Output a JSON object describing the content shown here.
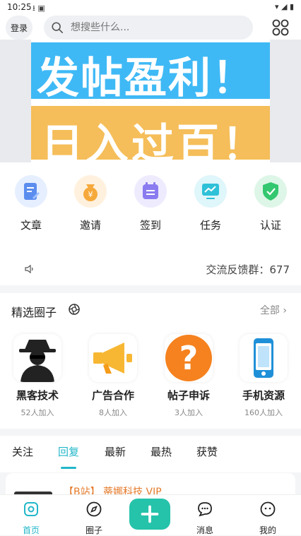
{
  "status_bar": {
    "time": "10:25"
  },
  "header": {
    "login_label": "登录",
    "search_placeholder": "想搜些什么..."
  },
  "banner": {
    "line1": "发帖盈利！",
    "line2": "日入过百！"
  },
  "features": [
    {
      "label": "文章",
      "icon": "article-icon",
      "color": "#5b8def"
    },
    {
      "label": "邀请",
      "icon": "money-bag-icon",
      "color": "#f6a93b"
    },
    {
      "label": "签到",
      "icon": "calendar-icon",
      "color": "#8a7cf0"
    },
    {
      "label": "任务",
      "icon": "chart-monitor-icon",
      "color": "#2ec1d8"
    },
    {
      "label": "认证",
      "icon": "shield-check-icon",
      "color": "#33c76f"
    }
  ],
  "feedback": {
    "text": "交流反馈群：677"
  },
  "circles_section": {
    "title": "精选圈子",
    "all_label": "全部",
    "items": [
      {
        "name": "黑客技术",
        "count": "52人加入",
        "icon": "hacker-icon"
      },
      {
        "name": "广告合作",
        "count": "8人加入",
        "icon": "megaphone-icon"
      },
      {
        "name": "帖子申诉",
        "count": "3人加入",
        "icon": "question-icon"
      },
      {
        "name": "手机资源",
        "count": "160人加入",
        "icon": "phone-icon"
      }
    ]
  },
  "tabs": [
    "关注",
    "回复",
    "最新",
    "最热",
    "获赞"
  ],
  "active_tab": "回复",
  "post_peek": {
    "title": "【B站】 蒂娜科技 VIP"
  },
  "bottom_nav": [
    {
      "label": "首页",
      "icon": "home-icon"
    },
    {
      "label": "圈子",
      "icon": "compass-icon"
    },
    {
      "label": "",
      "icon": "plus-icon"
    },
    {
      "label": "消息",
      "icon": "message-icon"
    },
    {
      "label": "我的",
      "icon": "profile-icon"
    }
  ],
  "colors": {
    "accent": "#22b7c9",
    "plus_button": "#25c3aa"
  }
}
